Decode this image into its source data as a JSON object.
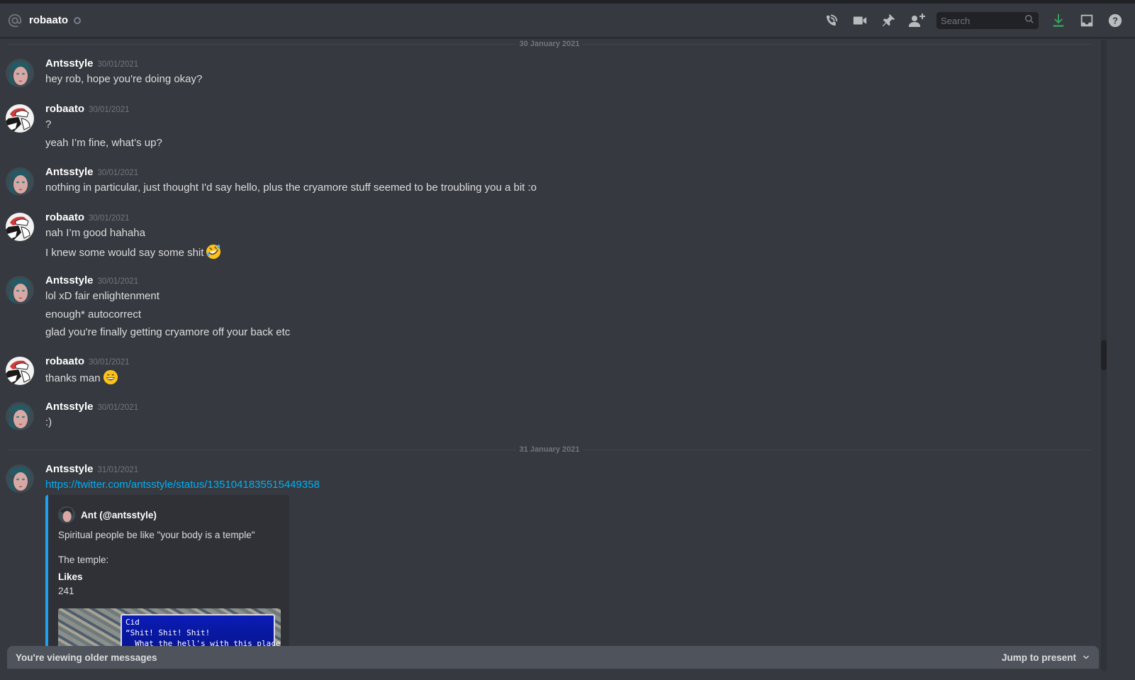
{
  "header": {
    "channel_icon": "at-icon",
    "title": "robaato",
    "status": "offline",
    "toolbar": {
      "icons": [
        "phone-call-icon",
        "video-call-icon",
        "pin-icon",
        "add-friend-icon"
      ],
      "search_placeholder": "Search",
      "right_icons": [
        "download-icon",
        "inbox-icon",
        "help-icon"
      ],
      "download_color": "#3ba55c"
    }
  },
  "dividers": [
    "30 January 2021",
    "31 January 2021"
  ],
  "messages": [
    {
      "author": "Antsstyle",
      "timestamp": "30/01/2021",
      "lines": [
        "hey rob, hope you're doing okay?"
      ]
    },
    {
      "author": "robaato",
      "timestamp": "30/01/2021",
      "lines": [
        "?",
        "yeah I’m fine, what’s up?"
      ]
    },
    {
      "author": "Antsstyle",
      "timestamp": "30/01/2021",
      "lines": [
        "nothing in particular, just thought I'd say hello, plus the cryamore stuff seemed to be troubling you a bit :o"
      ]
    },
    {
      "author": "robaato",
      "timestamp": "30/01/2021",
      "lines": [
        "nah I’m good hahaha",
        "I knew some would say some shit"
      ]
    },
    {
      "author": "Antsstyle",
      "timestamp": "30/01/2021",
      "lines": [
        "lol xD fair enlightenment",
        "enough* autocorrect",
        "glad you're finally getting cryamore off your back etc"
      ]
    },
    {
      "author": "robaato",
      "timestamp": "30/01/2021",
      "lines": [
        "thanks man"
      ]
    },
    {
      "author": "Antsstyle",
      "timestamp": "30/01/2021",
      "lines": [
        ":)"
      ]
    },
    {
      "author": "Antsstyle",
      "timestamp": "31/01/2021",
      "lines": [
        "https://twitter.com/antsstyle/status/1351041835515449358"
      ]
    }
  ],
  "emojis": {
    "rofl": "rolling-on-floor-laughing-emoji",
    "smile": "grinning-smile-emoji"
  },
  "embed": {
    "author": "Ant (@antsstyle)",
    "description": "Spiritual people be like \"your body is a temple\"",
    "description2": "The temple:",
    "field_name": "Likes",
    "field_value": "241",
    "image_dialog": {
      "speaker": "Cid",
      "line1": "“Shit! Shit! Shit!",
      "line2": "  What the hell's with this place!”"
    },
    "accent_color": "#1da1f2"
  },
  "older_bar": {
    "text": "You're viewing older messages",
    "jump_label": "Jump to present"
  }
}
